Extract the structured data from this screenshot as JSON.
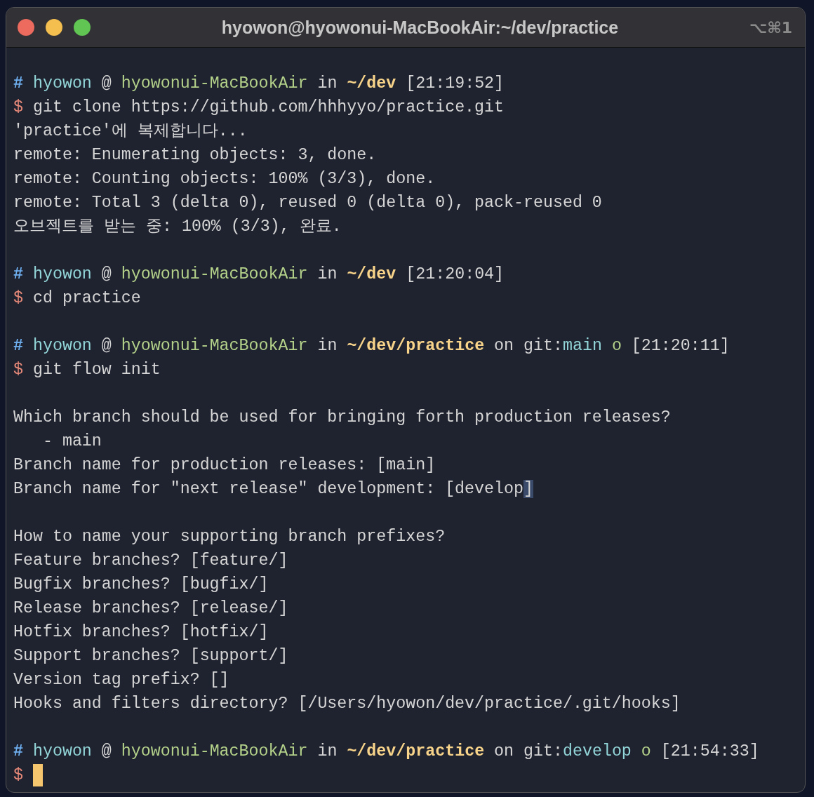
{
  "window": {
    "title": "hyowon@hyowonui-MacBookAir:~/dev/practice",
    "shortcut": "⌥⌘1"
  },
  "lines": [
    {
      "kind": "blank"
    },
    {
      "kind": "prompt",
      "segments": [
        {
          "text": "#",
          "kind": "hash"
        },
        {
          "text": "hyowon",
          "kind": "user"
        },
        {
          "text": "@",
          "kind": "plain"
        },
        {
          "text": "hyowonui-MacBookAir",
          "kind": "host"
        },
        {
          "text": "in",
          "kind": "plain"
        },
        {
          "text": "~/dev",
          "kind": "path"
        },
        {
          "text": "[21:19:52]",
          "kind": "plain"
        }
      ]
    },
    {
      "kind": "command",
      "symbol": "$",
      "text": "git clone https://github.com/hhhyyo/practice.git"
    },
    {
      "kind": "output",
      "text": "'practice'에 복제합니다..."
    },
    {
      "kind": "output",
      "text": "remote: Enumerating objects: 3, done."
    },
    {
      "kind": "output",
      "text": "remote: Counting objects: 100% (3/3), done."
    },
    {
      "kind": "output",
      "text": "remote: Total 3 (delta 0), reused 0 (delta 0), pack-reused 0"
    },
    {
      "kind": "output",
      "text": "오브젝트를 받는 중: 100% (3/3), 완료."
    },
    {
      "kind": "blank"
    },
    {
      "kind": "prompt",
      "segments": [
        {
          "text": "#",
          "kind": "hash"
        },
        {
          "text": "hyowon",
          "kind": "user"
        },
        {
          "text": "@",
          "kind": "plain"
        },
        {
          "text": "hyowonui-MacBookAir",
          "kind": "host"
        },
        {
          "text": "in",
          "kind": "plain"
        },
        {
          "text": "~/dev",
          "kind": "path"
        },
        {
          "text": "[21:20:04]",
          "kind": "plain"
        }
      ]
    },
    {
      "kind": "command",
      "symbol": "$",
      "text": "cd practice"
    },
    {
      "kind": "blank"
    },
    {
      "kind": "prompt",
      "segments": [
        {
          "text": "#",
          "kind": "hash"
        },
        {
          "text": "hyowon",
          "kind": "user"
        },
        {
          "text": "@",
          "kind": "plain"
        },
        {
          "text": "hyowonui-MacBookAir",
          "kind": "host"
        },
        {
          "text": "in",
          "kind": "plain"
        },
        {
          "text": "~/dev/practice",
          "kind": "path"
        },
        {
          "text": "on git:",
          "kind": "plain"
        },
        {
          "text": "main",
          "kind": "branch"
        },
        {
          "text": "o",
          "kind": "status"
        },
        {
          "text": "[21:20:11]",
          "kind": "plain"
        }
      ]
    },
    {
      "kind": "command",
      "symbol": "$",
      "text": "git flow init"
    },
    {
      "kind": "blank"
    },
    {
      "kind": "output",
      "text": "Which branch should be used for bringing forth production releases?"
    },
    {
      "kind": "output",
      "text": "   - main"
    },
    {
      "kind": "output",
      "text": "Branch name for production releases: [main]"
    },
    {
      "kind": "prompt",
      "segments": [
        {
          "text": "Branch name for \"next release\" development: [develop",
          "kind": "plain"
        },
        {
          "text": "]",
          "kind": "selected"
        }
      ]
    },
    {
      "kind": "blank"
    },
    {
      "kind": "output",
      "text": "How to name your supporting branch prefixes?"
    },
    {
      "kind": "output",
      "text": "Feature branches? [feature/]"
    },
    {
      "kind": "output",
      "text": "Bugfix branches? [bugfix/]"
    },
    {
      "kind": "output",
      "text": "Release branches? [release/]"
    },
    {
      "kind": "output",
      "text": "Hotfix branches? [hotfix/]"
    },
    {
      "kind": "output",
      "text": "Support branches? [support/]"
    },
    {
      "kind": "output",
      "text": "Version tag prefix? []"
    },
    {
      "kind": "output",
      "text": "Hooks and filters directory? [/Users/hyowon/dev/practice/.git/hooks]"
    },
    {
      "kind": "blank"
    },
    {
      "kind": "prompt",
      "segments": [
        {
          "text": "#",
          "kind": "hash"
        },
        {
          "text": "hyowon",
          "kind": "user"
        },
        {
          "text": "@",
          "kind": "plain"
        },
        {
          "text": "hyowonui-MacBookAir",
          "kind": "host"
        },
        {
          "text": "in",
          "kind": "plain"
        },
        {
          "text": "~/dev/practice",
          "kind": "path"
        },
        {
          "text": "on git:",
          "kind": "plain"
        },
        {
          "text": "develop",
          "kind": "branch"
        },
        {
          "text": "o",
          "kind": "status"
        },
        {
          "text": "[21:54:33]",
          "kind": "plain"
        }
      ]
    },
    {
      "kind": "command",
      "symbol": "$",
      "cursor": true
    }
  ]
}
